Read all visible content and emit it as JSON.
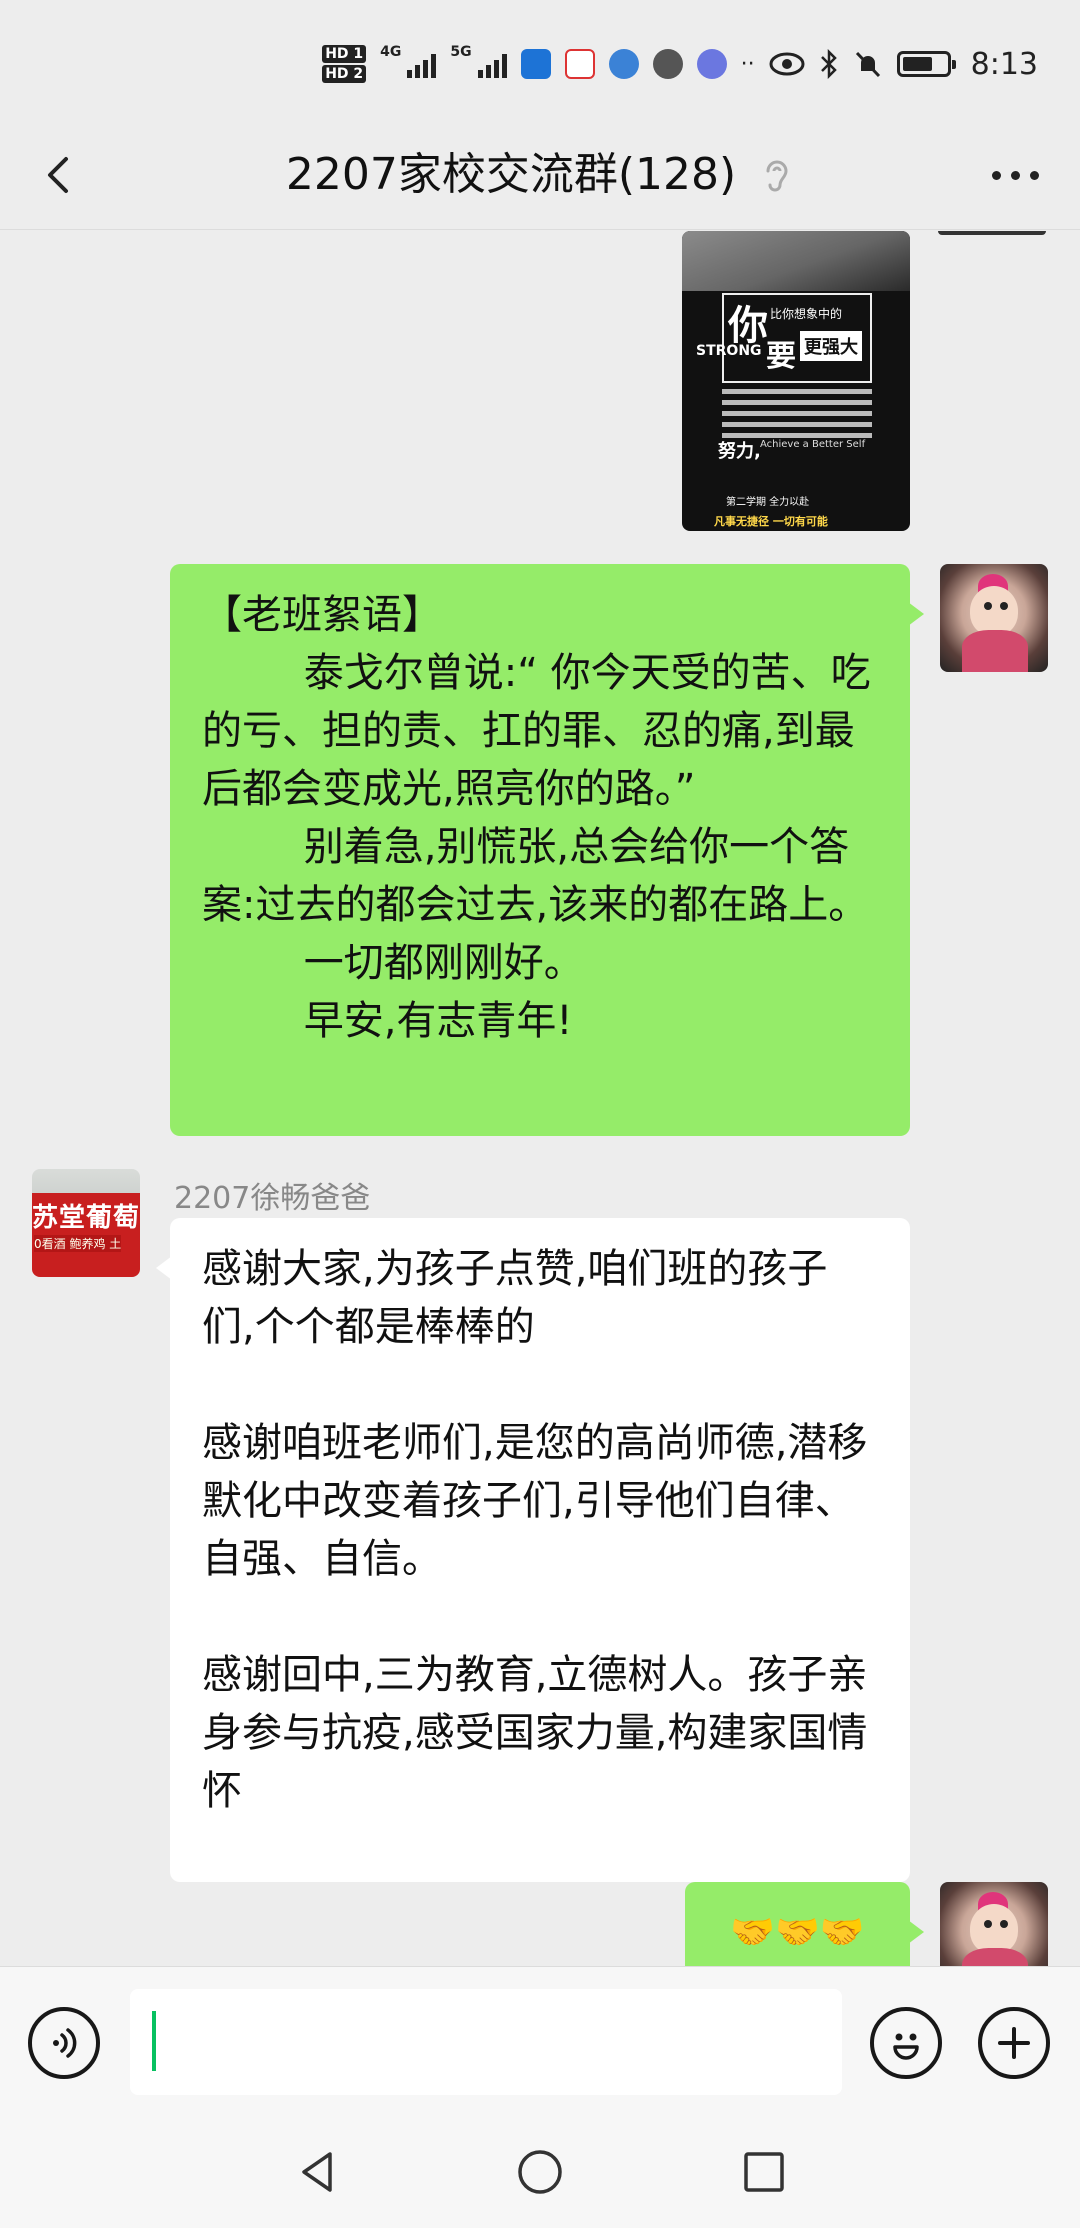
{
  "status_bar": {
    "sim1": "HD 1",
    "sim2": "HD 2",
    "net1": "4G",
    "net2": "5G",
    "time": "8:13",
    "battery_level": 0.7
  },
  "header": {
    "title": "2207家校交流群(128)",
    "back_icon": "chevron-left-icon",
    "mute_icon": "ear-icon",
    "more_icon": "more-horizontal-icon"
  },
  "messages": [
    {
      "type": "image",
      "from": "me",
      "poster": {
        "headline_big": "你",
        "headline_small": "比你想象中的",
        "strong": "STRONG",
        "yao": "要",
        "box": "更强大",
        "nuli": "努力,",
        "tagline": "Achieve a Better Self",
        "footer1": "第二学期    全力以赴",
        "footer2": "凡事无捷径    一切有可能"
      }
    },
    {
      "type": "text",
      "from": "me",
      "text": "【老班絮语】\n        泰戈尔曾说:“ 你今天受的苦、吃的亏、担的责、扛的罪、忍的痛,到最后都会变成光,照亮你的路。”\n        别着急,别慌张,总会给你一个答案:过去的都会过去,该来的都在路上。\n        一切都刚刚好。\n        早安,有志青年!"
    },
    {
      "type": "text",
      "from": "other",
      "sender": "2207徐畅爸爸",
      "avatar_sign": "苏堂葡萄",
      "avatar_sub": "0看酒 鲍养鸡 土",
      "text": "感谢大家,为孩子点赞,咱们班的孩子们,个个都是棒棒的\n\n感谢咱班老师们,是您的高尚师德,潜移默化中改变着孩子们,引导他们自律、自强、自信。\n\n感谢回中,三为教育,立德树人。孩子亲身参与抗疫,感受国家力量,构建家国情怀"
    },
    {
      "type": "emoji",
      "from": "me",
      "text": "🤝🤝🤝"
    }
  ],
  "input_bar": {
    "voice_icon": "voice-icon",
    "emoji_icon": "emoji-icon",
    "plus_icon": "plus-circle-icon",
    "input_value": ""
  },
  "nav_bar": {
    "back": "nav-back-icon",
    "home": "nav-home-icon",
    "recents": "nav-recents-icon"
  },
  "colors": {
    "bg": "#ededed",
    "bubble_green": "#95ec69",
    "bubble_white": "#ffffff",
    "accent": "#07c160"
  }
}
